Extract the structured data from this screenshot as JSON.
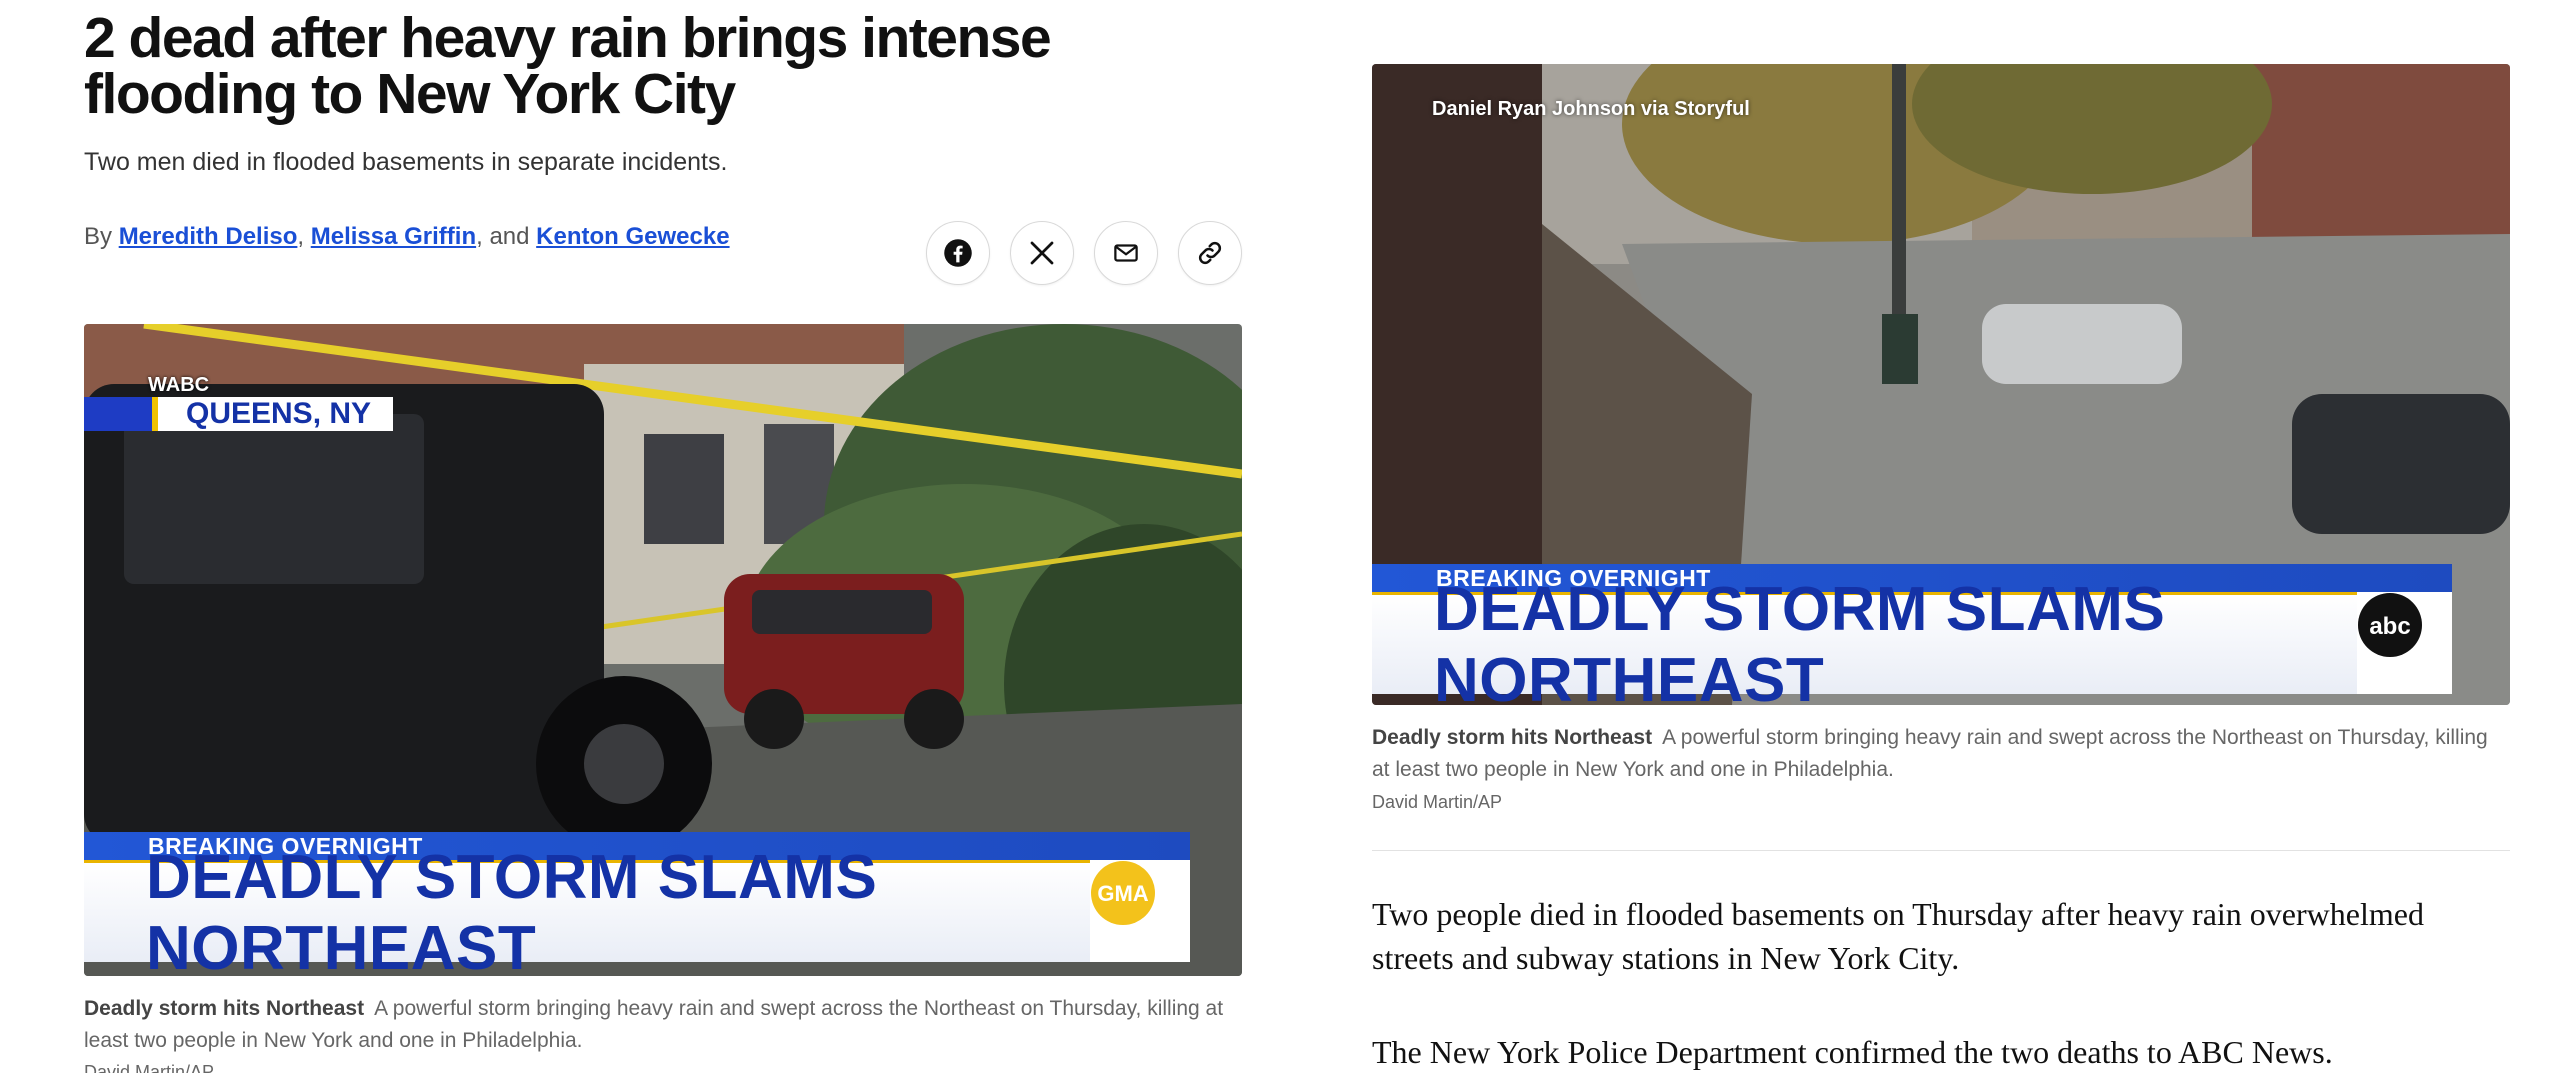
{
  "article": {
    "headline": "2 dead after heavy rain brings intense flooding to New York City",
    "subhead": "Two men died in flooded basements in separate incidents.",
    "byline": {
      "prefix": "By",
      "authors": [
        "Meredith Deliso",
        "Melissa Griffin",
        "Kenton Gewecke"
      ],
      "sep1": ",",
      "sep2": ", and"
    }
  },
  "share": {
    "icons": [
      "facebook-icon",
      "x-icon",
      "email-icon",
      "link-icon"
    ]
  },
  "left_media": {
    "location_source": "WABC",
    "location": "QUEENS, NY",
    "banner_top": "BREAKING OVERNIGHT",
    "banner_main": "DEADLY STORM SLAMS NORTHEAST",
    "logo": "GMA",
    "caption_title": "Deadly storm hits Northeast",
    "caption_text": "A powerful storm bringing heavy rain and swept across the Northeast on Thursday, killing at least two people in New York and one in Philadelphia.",
    "credit": "David Martin/AP"
  },
  "right_media": {
    "watermark": "Daniel Ryan Johnson via Storyful",
    "banner_top": "BREAKING OVERNIGHT",
    "banner_main": "DEADLY STORM SLAMS NORTHEAST",
    "logo": "abc",
    "caption_title": "Deadly storm hits Northeast",
    "caption_text": "A powerful storm bringing heavy rain and swept across the Northeast on Thursday, killing at least two people in New York and one in Philadelphia.",
    "credit": "David Martin/AP"
  },
  "body": {
    "p1": "Two people died in flooded basements on Thursday after heavy rain overwhelmed streets and subway stations in New York City.",
    "p2": "The New York Police Department confirmed the two deaths to ABC News."
  },
  "colors": {
    "link": "#1a4fd6",
    "banner_blue": "#2257d6",
    "banner_text": "#1432a6",
    "accent_yellow": "#f1c200"
  }
}
